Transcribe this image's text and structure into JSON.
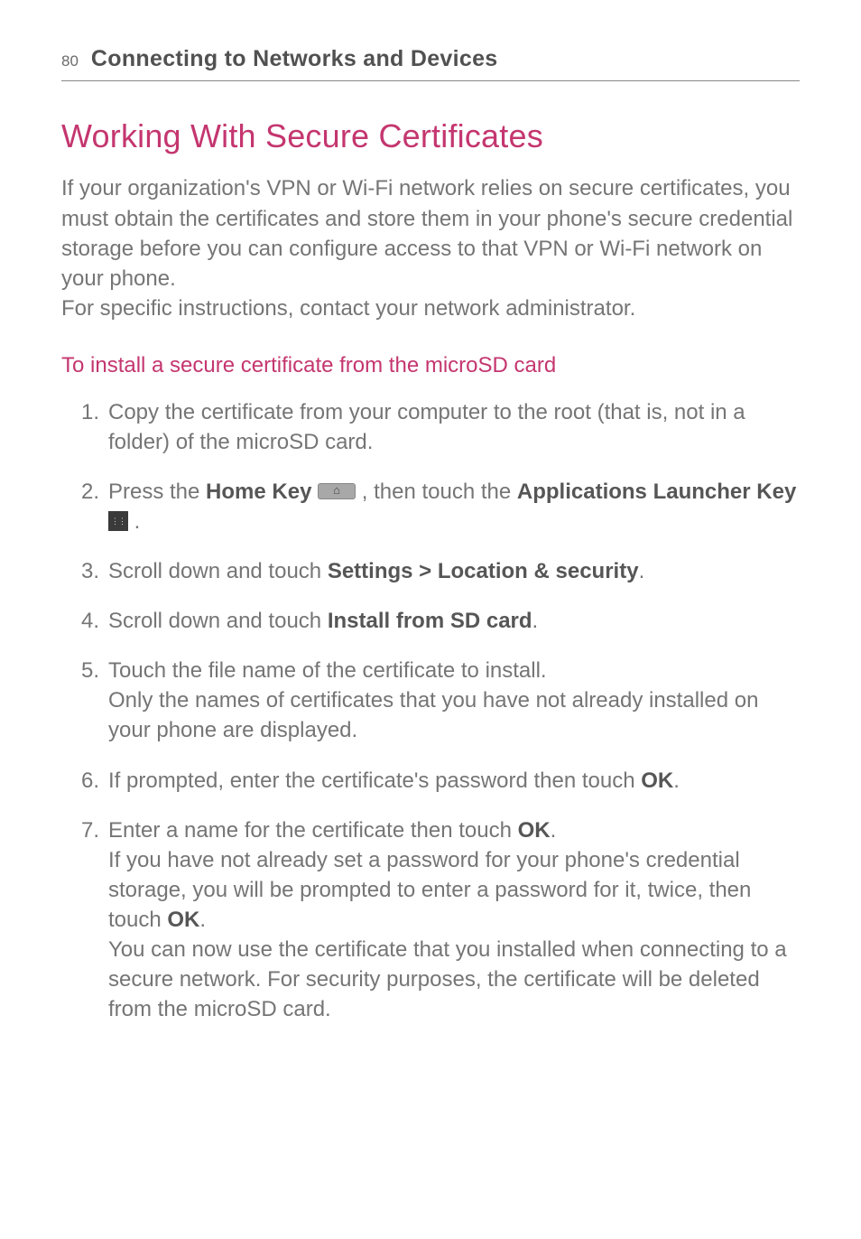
{
  "pageNumber": "80",
  "sectionTitle": "Connecting to Networks and Devices",
  "mainTitle": "Working With Secure Certificates",
  "introPara1": "If your organization's VPN or Wi-Fi network relies on secure certificates, you must obtain the certificates and store them in your phone's secure credential storage before you can configure access to that VPN or Wi-Fi network on your phone.",
  "introPara2": "For specific instructions, contact your network administrator.",
  "subHeading": "To install a secure certificate from the microSD card",
  "steps": {
    "s1": "Copy the certificate from your computer to the root (that is, not in a folder) of the microSD card.",
    "s2_a": "Press the ",
    "s2_homeKey": "Home Key",
    "s2_b": " , then touch the ",
    "s2_appLauncher": "Applications Launcher Key",
    "s2_c": " .",
    "s3_a": "Scroll down and touch ",
    "s3_bold": "Settings > Location & security",
    "s3_b": ".",
    "s4_a": "Scroll down and touch ",
    "s4_bold": "Install from SD card",
    "s4_b": ".",
    "s5_a": "Touch the file name of the certificate to install.",
    "s5_b": "Only the names of certificates that you have not already installed on your phone are displayed.",
    "s6_a": "If prompted, enter the certificate's password then touch ",
    "s6_ok": "OK",
    "s6_b": ".",
    "s7_a": "Enter a name for the certificate then touch ",
    "s7_ok1": "OK",
    "s7_b": ".",
    "s7_c": "If you have not already set a password for your phone's credential storage, you will be prompted to enter a password for it, twice, then touch ",
    "s7_ok2": "OK",
    "s7_d": ".",
    "s7_e": "You can now use the certificate that you installed when connecting to a secure network. For security purposes, the certificate will be deleted from the microSD card."
  }
}
